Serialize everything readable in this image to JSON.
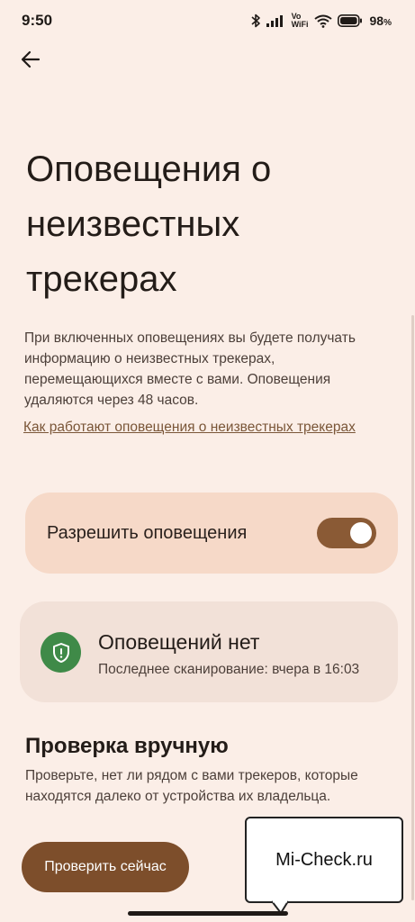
{
  "status_bar": {
    "time": "9:50",
    "volte_line1": "Vo",
    "volte_line2": "WiFi",
    "battery_percent": "98",
    "battery_symbol": "%",
    "battery_level": 0.98
  },
  "page": {
    "title": "Оповещения о неизвестных трекерах",
    "description": "При включенных оповещениях вы будете получать информацию о неизвестных трекерах, перемещающихся вместе с вами. Оповещения удаляются через 48 часов.",
    "learn_more_link": "Как работают оповещения о неизвестных трекерах"
  },
  "toggle_card": {
    "label": "Разрешить оповещения",
    "enabled": true
  },
  "status_card": {
    "icon": "shield-check-icon",
    "title": "Оповещений нет",
    "subtitle": "Последнее сканирование: вчера в 16:03"
  },
  "manual_check": {
    "title": "Проверка вручную",
    "description": "Проверьте, нет ли рядом с вами трекеров, которые находятся далеко от устройства их владельца.",
    "button_label": "Проверить сейчас"
  },
  "watermark": {
    "text": "Mi-Check.ru"
  },
  "colors": {
    "background": "#fbeee7",
    "toggle_card": "#f6d9c8",
    "accent": "#7d4e2b",
    "shield_green": "#3f8a48"
  }
}
